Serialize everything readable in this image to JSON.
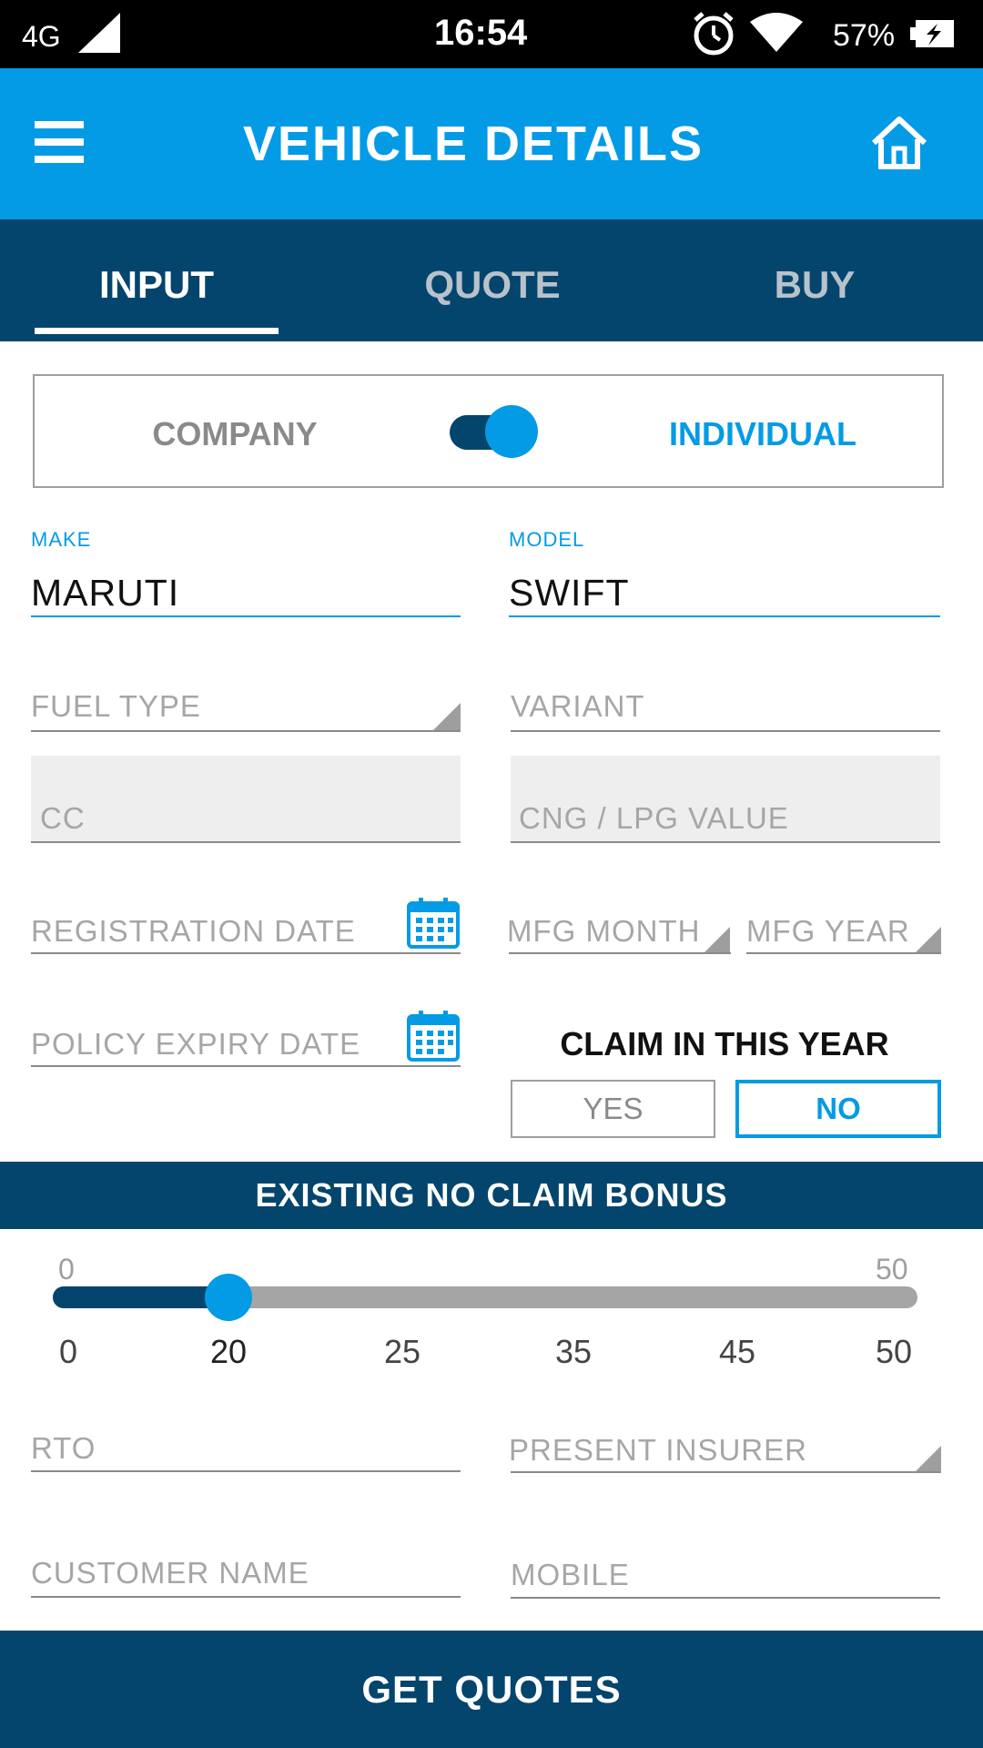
{
  "status_bar": {
    "network": "4G",
    "time": "16:54",
    "battery": "57%"
  },
  "app_bar": {
    "title": "VEHICLE DETAILS",
    "menu_icon": "hamburger-menu-icon",
    "home_icon": "home-icon"
  },
  "tabs": [
    {
      "label": "INPUT",
      "active": true
    },
    {
      "label": "QUOTE",
      "active": false
    },
    {
      "label": "BUY",
      "active": false
    }
  ],
  "entity_toggle": {
    "left_label": "COMPANY",
    "right_label": "INDIVIDUAL",
    "selected": "INDIVIDUAL"
  },
  "form": {
    "make": {
      "label": "MAKE",
      "value": "MARUTI"
    },
    "model": {
      "label": "MODEL",
      "value": "SWIFT"
    },
    "fuel_type": {
      "placeholder": "FUEL TYPE"
    },
    "variant": {
      "placeholder": "VARIANT"
    },
    "cc": {
      "placeholder": "CC"
    },
    "cng_lpg": {
      "placeholder": "CNG / LPG VALUE"
    },
    "registration_date": {
      "placeholder": "REGISTRATION DATE"
    },
    "mfg_month": {
      "placeholder": "MFG MONTH"
    },
    "mfg_year": {
      "placeholder": "MFG YEAR"
    },
    "policy_expiry": {
      "placeholder": "POLICY EXPIRY DATE"
    },
    "claim": {
      "title": "CLAIM IN THIS YEAR",
      "yes": "YES",
      "no": "NO",
      "selected": "NO"
    },
    "rto": {
      "placeholder": "RTO"
    },
    "present_insurer": {
      "placeholder": "PRESENT INSURER"
    },
    "customer_name": {
      "placeholder": "CUSTOMER NAME"
    },
    "mobile": {
      "placeholder": "MOBILE"
    }
  },
  "ncb": {
    "title": "EXISTING NO CLAIM BONUS",
    "min_label": "0",
    "max_label": "50",
    "value": 20,
    "ticks": [
      "0",
      "20",
      "25",
      "35",
      "45",
      "50"
    ]
  },
  "get_quotes_label": "GET QUOTES",
  "colors": {
    "primary": "#039be5",
    "dark": "#04456d"
  }
}
